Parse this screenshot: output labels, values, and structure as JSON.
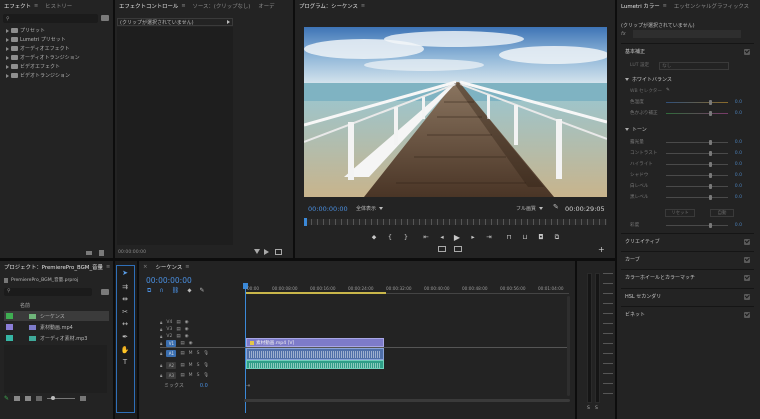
{
  "effects_panel": {
    "tab_effects": "エフェクト",
    "tab_history": "ヒストリー",
    "items": [
      "プリセット",
      "Lumetri プリセット",
      "オーディオエフェクト",
      "オーディオトランジション",
      "ビデオエフェクト",
      "ビデオトランジション"
    ]
  },
  "effect_controls": {
    "tab_effect_controls": "エフェクトコントロール",
    "tab_source": "ソース：(クリップなし)",
    "tab_audio": "オーデ",
    "no_clip_message": "(クリップが選択されていません)",
    "timecode": "00:00:00:00"
  },
  "program_monitor": {
    "title": "プログラム：シーケンス",
    "current_time": "00:00:00:00",
    "zoom": "全体表示",
    "quality": "フル画質",
    "duration": "00:00:29:05"
  },
  "project_panel": {
    "title": "プロジェクト：PremierePro_BGM_音量",
    "file_name": "PremierePro_BGM_音量.prproj",
    "column_name": "名前",
    "items": [
      {
        "name": "シーケンス",
        "color": "#3fae52"
      },
      {
        "name": "素材動画.mp4",
        "color": "#8a7dd6"
      },
      {
        "name": "オーディオ素材.mp3",
        "color": "#36b6a5"
      }
    ]
  },
  "timeline": {
    "title": "シーケンス",
    "timecode": "00:00:00:00",
    "ruler": [
      "00:00",
      "00:00:08:00",
      "00:00:16:00",
      "00:00:24:00",
      "00:00:32:00",
      "00:00:40:00",
      "00:00:48:00",
      "00:00:56:00",
      "00:01:04:00"
    ],
    "video_tracks": [
      "V4",
      "V3",
      "V2",
      "V1"
    ],
    "audio_tracks": [
      "A1",
      "A2",
      "A3"
    ],
    "mix_label": "ミックス",
    "mix_value": "0.0",
    "video_clip_label": "素材動画.mp4 [V]",
    "audio_solo": "S",
    "audio_mute": "M",
    "meter_labels": [
      "S",
      "S"
    ]
  },
  "lumetri": {
    "tab_lumetri": "Lumetri カラー",
    "tab_essential": "エッセンシャルグラフィックス",
    "no_clip": "(クリップが選択されていません)",
    "basic": "基本補正",
    "lut_label": "LUT 設定",
    "lut_value": "なし",
    "white_balance": "ホワイトバランス",
    "wb_selector": "WB セレクター",
    "temperature": "色温度",
    "tint": "色かぶり補正",
    "tone": "トーン",
    "tone_rows": [
      "露光量",
      "コントラスト",
      "ハイライト",
      "シャドウ",
      "白レベル",
      "黒レベル"
    ],
    "reset_btn": "リセット",
    "auto_btn": "自動",
    "saturation": "彩度",
    "value": "0.0",
    "sections": [
      "クリエイティブ",
      "カーブ",
      "カラーホイールとカラーマッチ",
      "HSL セカンダリ",
      "ビネット"
    ]
  },
  "accent_color": "#3b89d8"
}
